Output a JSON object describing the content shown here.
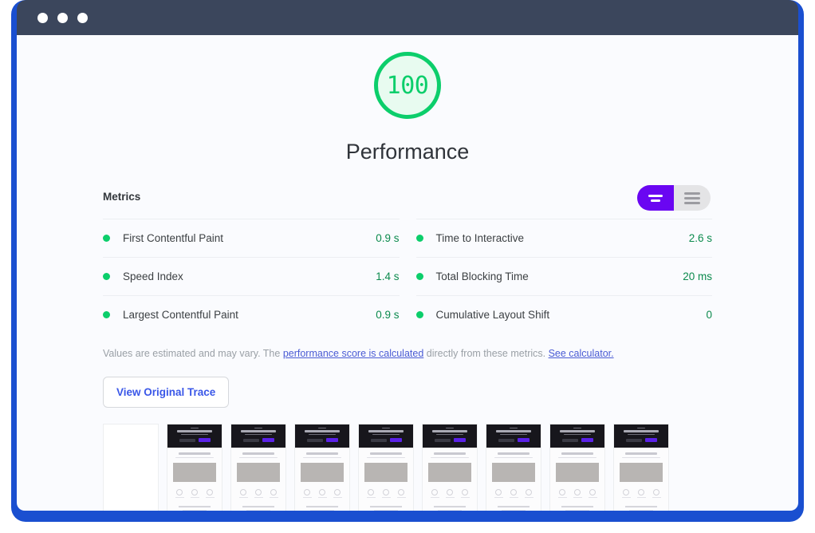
{
  "window": {
    "dots": [
      "close-dot",
      "minimize-dot",
      "maximize-dot"
    ],
    "frame_color": "#1a4fd0",
    "titlebar_color": "#3b465c"
  },
  "gauge": {
    "score": "100",
    "title": "Performance",
    "color": "#0cce6b",
    "fill": "#e8fbf0"
  },
  "metrics": {
    "label": "Metrics",
    "toggle": {
      "active": "expanded-view",
      "inactive": "list-view",
      "active_color": "#6a06f2",
      "track_color": "#e4e4e6"
    },
    "left_column": [
      {
        "name": "First Contentful Paint",
        "value": "0.9 s",
        "status": "pass"
      },
      {
        "name": "Speed Index",
        "value": "1.4 s",
        "status": "pass"
      },
      {
        "name": "Largest Contentful Paint",
        "value": "0.9 s",
        "status": "pass"
      }
    ],
    "right_column": [
      {
        "name": "Time to Interactive",
        "value": "2.6 s",
        "status": "pass"
      },
      {
        "name": "Total Blocking Time",
        "value": "20 ms",
        "status": "pass"
      },
      {
        "name": "Cumulative Layout Shift",
        "value": "0",
        "status": "pass"
      }
    ]
  },
  "footnote": {
    "part1": "Values are estimated and may vary. The ",
    "link1": "performance score is calculated",
    "part2": " directly from these metrics. ",
    "link2": "See calculator."
  },
  "trace_button": {
    "label": "View Original Trace"
  },
  "filmstrip": {
    "count": 9,
    "frames": [
      {
        "blank": true
      },
      {
        "blank": false
      },
      {
        "blank": false
      },
      {
        "blank": false
      },
      {
        "blank": false
      },
      {
        "blank": false
      },
      {
        "blank": false
      },
      {
        "blank": false
      },
      {
        "blank": false
      }
    ]
  }
}
